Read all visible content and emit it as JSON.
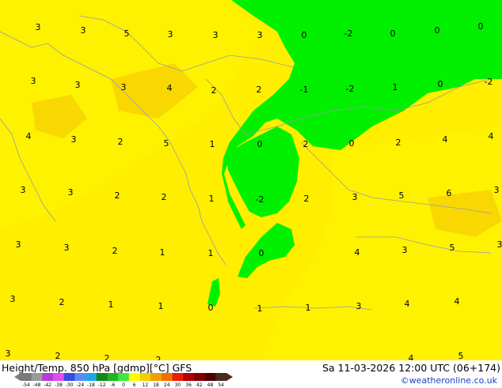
{
  "header": {
    "title_left": "Height/Temp. 850 hPa [gdmp][°C] GFS",
    "title_right": "Sa 11-03-2026 12:00 UTC (06+174)",
    "credit": "©weatheronline.co.uk"
  },
  "legend": {
    "ticks": [
      "-54",
      "-48",
      "-42",
      "-38",
      "-30",
      "-24",
      "-18",
      "-12",
      "-6",
      "0",
      "6",
      "12",
      "18",
      "24",
      "30",
      "36",
      "42",
      "48",
      "54"
    ],
    "colors": [
      "#7a7a7a",
      "#9a9a9a",
      "#b43bd4",
      "#e04df0",
      "#3a4be0",
      "#5a8cf8",
      "#1fa7e8",
      "#138a13",
      "#22b422",
      "#3ee83e",
      "#ffff00",
      "#f0d000",
      "#f0a000",
      "#f07000",
      "#e82000",
      "#b00000",
      "#800000",
      "#500000",
      "#4a2a1a"
    ]
  },
  "colors": {
    "warm_yellow": "#ffee00",
    "light_yellow": "#fff200",
    "deep_yellow": "#f8d800",
    "green": "#00f000",
    "coast": "#9a9aaa"
  },
  "isotherm_labels": [
    {
      "t": "3"
    },
    {
      "t": "3"
    },
    {
      "t": "5"
    },
    {
      "t": "3"
    },
    {
      "t": "3"
    },
    {
      "t": "3"
    },
    {
      "t": "0"
    },
    {
      "t": "-2"
    },
    {
      "t": "0"
    },
    {
      "t": "0"
    },
    {
      "t": "0"
    },
    {
      "t": "3"
    },
    {
      "t": "3"
    },
    {
      "t": "3"
    },
    {
      "t": "4"
    },
    {
      "t": "2"
    },
    {
      "t": "2"
    },
    {
      "t": "-1"
    },
    {
      "t": "-2"
    },
    {
      "t": "1"
    },
    {
      "t": "0"
    },
    {
      "t": "-2"
    },
    {
      "t": "4"
    },
    {
      "t": "3"
    },
    {
      "t": "2"
    },
    {
      "t": "5"
    },
    {
      "t": "1"
    },
    {
      "t": "0"
    },
    {
      "t": "2"
    },
    {
      "t": "0"
    },
    {
      "t": "2"
    },
    {
      "t": "4"
    },
    {
      "t": "4"
    },
    {
      "t": "3"
    },
    {
      "t": "3"
    },
    {
      "t": "2"
    },
    {
      "t": "2"
    },
    {
      "t": "1"
    },
    {
      "t": "-2"
    },
    {
      "t": "2"
    },
    {
      "t": "3"
    },
    {
      "t": "5"
    },
    {
      "t": "6"
    },
    {
      "t": "3"
    },
    {
      "t": "3"
    },
    {
      "t": "3"
    },
    {
      "t": "2"
    },
    {
      "t": "1"
    },
    {
      "t": "1"
    },
    {
      "t": "0"
    },
    {
      "t": "4"
    },
    {
      "t": "3"
    },
    {
      "t": "5"
    },
    {
      "t": "3"
    },
    {
      "t": "3"
    },
    {
      "t": "2"
    },
    {
      "t": "1"
    },
    {
      "t": "1"
    },
    {
      "t": "0"
    },
    {
      "t": "1"
    },
    {
      "t": "1"
    },
    {
      "t": "3"
    },
    {
      "t": "4"
    },
    {
      "t": "4"
    },
    {
      "t": "3"
    },
    {
      "t": "2"
    },
    {
      "t": "2"
    },
    {
      "t": "2"
    },
    {
      "t": "4"
    },
    {
      "t": "5"
    }
  ]
}
